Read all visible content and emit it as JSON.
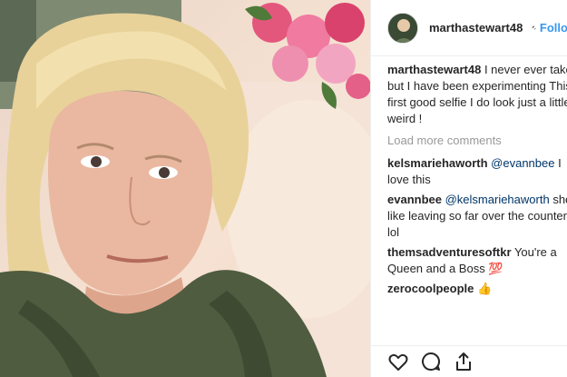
{
  "post": {
    "author": "marthastewart48",
    "dot": "•",
    "follow_label": "Follow",
    "caption": "I never ever take but I have been experimenting This first good selfie I do look just a little weird !",
    "load_more": "Load more comments",
    "comments": [
      {
        "user": "kelsmariehaworth",
        "mention": "@evannbee",
        "text": "I love this"
      },
      {
        "user": "evannbee",
        "mention": "@kelsmariehaworth",
        "text": "she's like leaving so far over the counter lol"
      },
      {
        "user": "themsadventuresoftkr",
        "mention": "",
        "text": "You're a Queen and a Boss 💯"
      },
      {
        "user": "zerocoolpeople",
        "mention": "",
        "text": "👍"
      }
    ]
  },
  "icons": [
    "heart-icon",
    "comment-icon",
    "share-icon"
  ],
  "colors": {
    "link": "#3897f0",
    "mention": "#003569",
    "muted": "#999999",
    "verified": "#3897f0"
  }
}
